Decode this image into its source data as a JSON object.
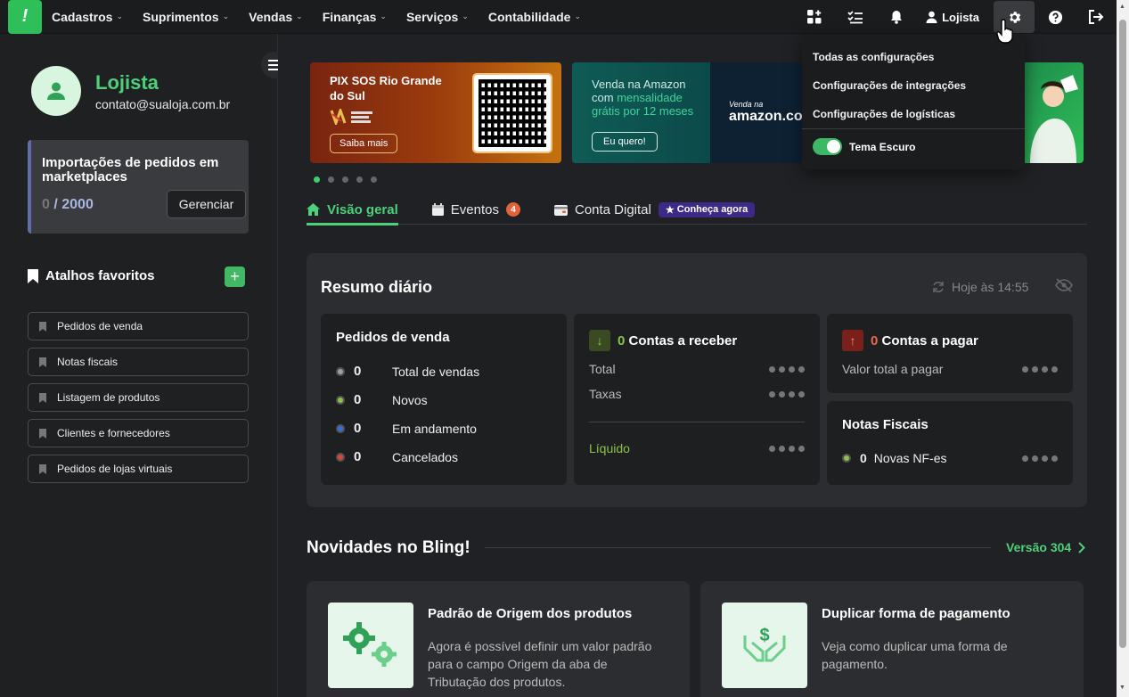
{
  "topbar": {
    "logo": "!",
    "menu": [
      "Cadastros",
      "Suprimentos",
      "Vendas",
      "Finanças",
      "Serviços",
      "Contabilidade"
    ],
    "user_label": "Lojista"
  },
  "settings_menu": {
    "items": [
      "Todas as configurações",
      "Configurações de integrações",
      "Configurações de logísticas"
    ],
    "dark_toggle_label": "Tema Escuro"
  },
  "sidebar": {
    "name": "Lojista",
    "email": "contato@sualoja.com.br",
    "import": {
      "title": "Importações de pedidos em marketplaces",
      "used": "0",
      "separator": " / ",
      "limit": "2000",
      "button": "Gerenciar"
    },
    "favorites_title": "Atalhos favoritos",
    "favorites": [
      "Pedidos de venda",
      "Notas fiscais",
      "Listagem de produtos",
      "Clientes e fornecedores",
      "Pedidos de lojas virtuais"
    ]
  },
  "banners": {
    "pix": {
      "title": "PIX SOS Rio Grande do Sul",
      "button": "Saiba mais"
    },
    "amazon": {
      "line1": "Venda na Amazon",
      "line2": "com",
      "highlight1": "mensalidade",
      "highlight2": "grátis por 12 meses",
      "button": "Eu quero!",
      "logo_small": "Venda na",
      "logo": "amazon.com.br"
    }
  },
  "tabs": {
    "overview": "Visão geral",
    "events": "Eventos",
    "events_count": "4",
    "digital": "Conta Digital",
    "digital_badge": "Conheça agora"
  },
  "resumo": {
    "title": "Resumo diário",
    "updated": "Hoje às 14:55",
    "vendas": {
      "title": "Pedidos de venda",
      "rows": [
        {
          "value": "0",
          "label": "Total de vendas",
          "color": "#9e9e9e"
        },
        {
          "value": "0",
          "label": "Novos",
          "color": "#8bc34a"
        },
        {
          "value": "0",
          "label": "Em andamento",
          "color": "#2f6fe0"
        },
        {
          "value": "0",
          "label": "Cancelados",
          "color": "#e0452f"
        }
      ]
    },
    "receber": {
      "count": "0",
      "title": "Contas a receber",
      "total": "Total",
      "taxas": "Taxas",
      "liquido": "Líquido"
    },
    "pagar": {
      "count": "0",
      "title": "Contas a pagar",
      "valor": "Valor total a pagar"
    },
    "notas": {
      "title": "Notas Fiscais",
      "count": "0",
      "label": "Novas NF-es"
    }
  },
  "novidades": {
    "title": "Novidades no Bling!",
    "version": "Versão 304",
    "cards": [
      {
        "title": "Padrão de Origem dos produtos",
        "text": "Agora é possível definir um valor padrão para o campo Origem da aba de Tributação dos produtos."
      },
      {
        "title": "Duplicar forma de pagamento",
        "text": "Veja como duplicar uma forma de pagamento."
      }
    ]
  },
  "colors": {
    "accent": "#4ed07a",
    "brand": "#2fbf58",
    "badge": "#e2633b"
  }
}
